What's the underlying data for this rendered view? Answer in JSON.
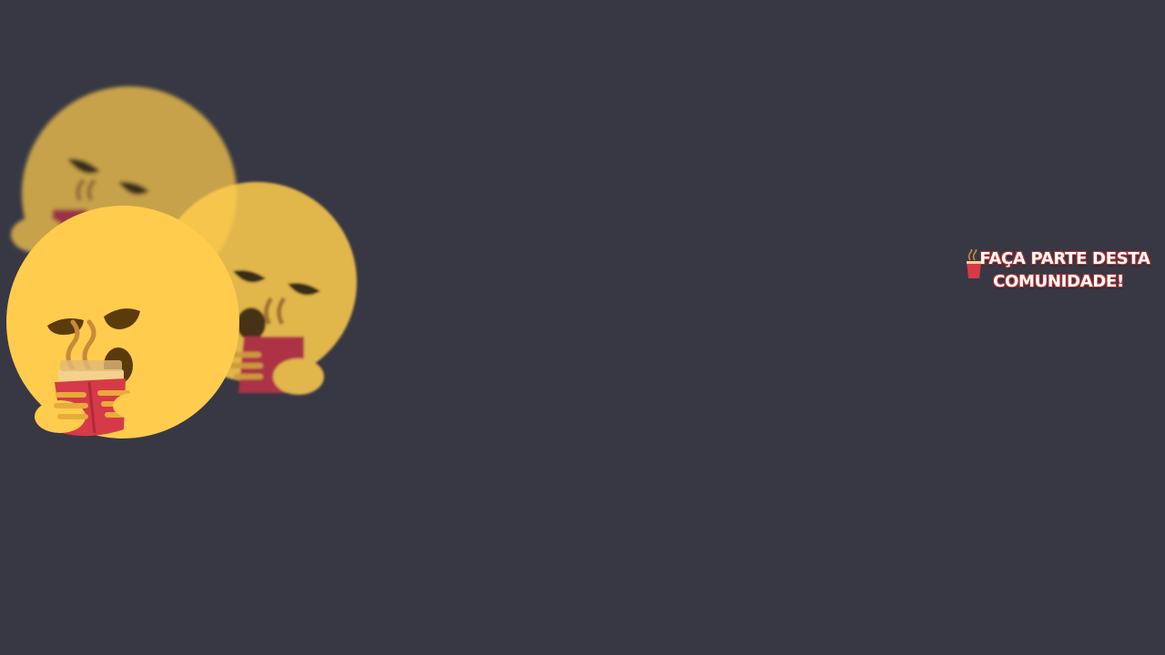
{
  "background_color": "#383844",
  "accent_color": "#d63a48",
  "emoji_color": "#ffcc4d",
  "art": {
    "icon": "yawning-reading-face-icon"
  },
  "cta": {
    "icon": "hot-drink-icon",
    "line1": "FAÇA PARTE DESTA",
    "line2": "COMUNIDADE!"
  }
}
